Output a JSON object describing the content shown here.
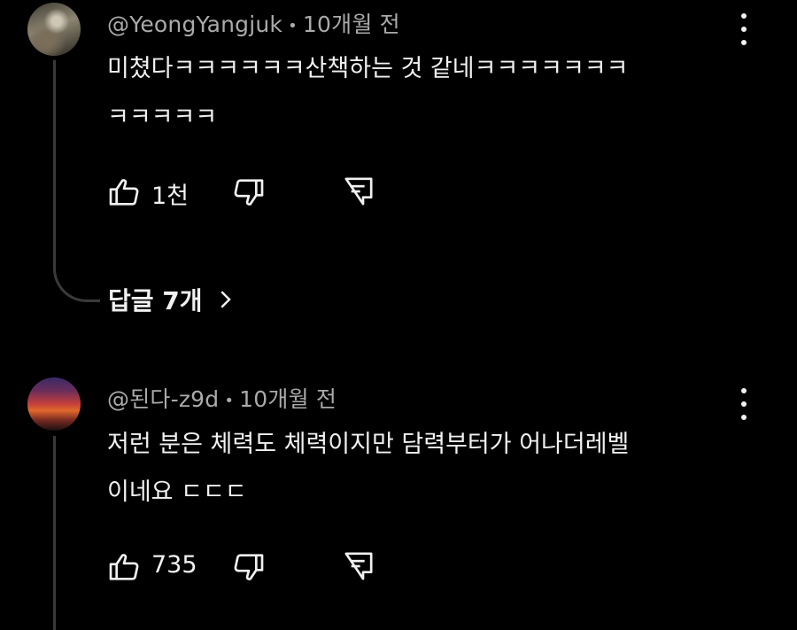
{
  "comments": [
    {
      "author": "@YeongYangjuk",
      "time": "10개월 전",
      "lines": [
        "미쳤다ㅋㅋㅋㅋㅋㅋ산책하는 것 같네ㅋㅋㅋㅋㅋㅋㅋ",
        "ㅋㅋㅋㅋㅋ"
      ],
      "likes": "1천",
      "replies_label": "답글 7개"
    },
    {
      "author": "@된다-z9d",
      "time": "10개월 전",
      "lines": [
        "저런 분은 체력도 체력이지만 담력부터가 어나더레벨",
        "이네요 ㄷㄷㄷ"
      ],
      "likes": "735"
    }
  ],
  "icons": {
    "like": "thumbs-up-icon",
    "dislike": "thumbs-down-icon",
    "reply": "reply-icon",
    "more": "more-vert-icon",
    "chevron": "chevron-right-icon"
  },
  "colors": {
    "background": "#000000",
    "text": "#f1f1f1",
    "meta": "#aaaaaa",
    "thread": "#3a3a3a"
  }
}
